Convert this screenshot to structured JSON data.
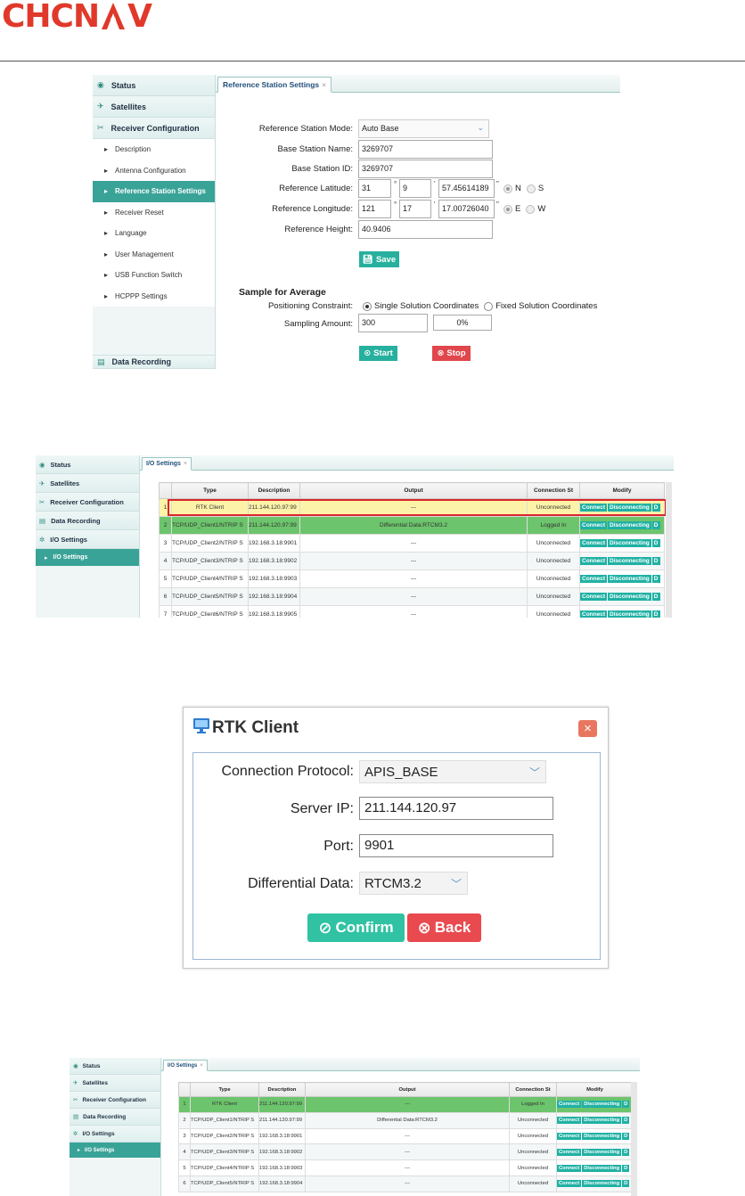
{
  "logo": {
    "text_left": "CHCN",
    "text_right": "V",
    "brand_color": "#e0392b"
  },
  "panel1": {
    "sidebar": [
      {
        "label": "Status",
        "icon": "status-icon"
      },
      {
        "label": "Satellites",
        "icon": "satellite-icon"
      },
      {
        "label": "Receiver Configuration",
        "icon": "tools-icon"
      }
    ],
    "subitems": [
      "Description",
      "Antenna Configuration",
      "Reference Station Settings",
      "Receiver Reset",
      "Language",
      "User Management",
      "USB Function Switch",
      "HCPPP Settings"
    ],
    "bottom_item": "Data Recording",
    "tab": "Reference Station Settings",
    "form": {
      "mode_label": "Reference Station Mode:",
      "mode_value": "Auto Base",
      "name_label": "Base Station Name:",
      "name_value": "3269707",
      "id_label": "Base Station ID:",
      "id_value": "3269707",
      "lat_label": "Reference Latitude:",
      "lat_deg": "31",
      "lat_min": "9",
      "lat_sec": "57.45614189",
      "lon_label": "Reference Longitude:",
      "lon_deg": "121",
      "lon_min": "17",
      "lon_sec": "17.00726040",
      "deg_unit": "°",
      "min_unit": "'",
      "sec_unit": "\"",
      "n": "N",
      "s": "S",
      "e": "E",
      "w": "W",
      "height_label": "Reference Height:",
      "height_value": "40.9406",
      "save": "Save",
      "section": "Sample for Average",
      "constraint_label": "Positioning Constraint:",
      "opt_single": "Single Solution Coordinates",
      "opt_fixed": "Fixed Solution Coordinates",
      "amount_label": "Sampling Amount:",
      "amount_value": "300",
      "progress": "0%",
      "start": "Start",
      "stop": "Stop"
    }
  },
  "io_sidebar": {
    "items": [
      "Status",
      "Satellites",
      "Receiver Configuration",
      "Data Recording",
      "I/O Settings"
    ],
    "sub": "I/O Settings"
  },
  "io_tab": "I/O Settings",
  "table_headers": [
    "Type",
    "Description",
    "Output",
    "Connection St",
    "Modify"
  ],
  "buttons": {
    "connect": "Connect",
    "disconnect": "Disconnecting",
    "d": "D"
  },
  "table1": [
    {
      "n": "1",
      "type": "RTK Client",
      "desc": "211.144.120.97:99",
      "output": "---",
      "status": "Unconnected"
    },
    {
      "n": "2",
      "type": "TCP/UDP_Client1/NTRIP S",
      "desc": "211.144.120.97:99",
      "output": "Differential Data:RTCM3.2",
      "status": "Logged In"
    },
    {
      "n": "3",
      "type": "TCP/UDP_Client2/NTRIP S",
      "desc": "192.168.3.18:9901",
      "output": "---",
      "status": "Unconnected"
    },
    {
      "n": "4",
      "type": "TCP/UDP_Client3/NTRIP S",
      "desc": "192.168.3.18:9902",
      "output": "---",
      "status": "Unconnected"
    },
    {
      "n": "5",
      "type": "TCP/UDP_Client4/NTRIP S",
      "desc": "192.168.3.18:9903",
      "output": "---",
      "status": "Unconnected"
    },
    {
      "n": "6",
      "type": "TCP/UDP_Client5/NTRIP S",
      "desc": "192.168.3.18:9904",
      "output": "---",
      "status": "Unconnected"
    },
    {
      "n": "7",
      "type": "TCP/UDP_Client6/NTRIP S",
      "desc": "192.168.3.18:9905",
      "output": "---",
      "status": "Unconnected"
    }
  ],
  "dialog": {
    "title": "RTK Client",
    "protocol_label": "Connection Protocol:",
    "protocol_value": "APIS_BASE",
    "ip_label": "Server IP:",
    "ip_value": "211.144.120.97",
    "port_label": "Port:",
    "port_value": "9901",
    "diff_label": "Differential Data:",
    "diff_value": "RTCM3.2",
    "confirm": "Confirm",
    "back": "Back"
  },
  "table2": [
    {
      "n": "1",
      "type": "RTK Client",
      "desc": "211.144.120.97:99",
      "output": "---",
      "status": "Logged In"
    },
    {
      "n": "2",
      "type": "TCP/UDP_Client1/NTRIP S",
      "desc": "211.144.120.97:99",
      "output": "Differential Data:RTCM3.2",
      "status": "Unconnected"
    },
    {
      "n": "3",
      "type": "TCP/UDP_Client2/NTRIP S",
      "desc": "192.168.3.18:9901",
      "output": "---",
      "status": "Unconnected"
    },
    {
      "n": "4",
      "type": "TCP/UDP_Client3/NTRIP S",
      "desc": "192.168.3.18:9902",
      "output": "---",
      "status": "Unconnected"
    },
    {
      "n": "5",
      "type": "TCP/UDP_Client4/NTRIP S",
      "desc": "192.168.3.18:9903",
      "output": "---",
      "status": "Unconnected"
    },
    {
      "n": "6",
      "type": "TCP/UDP_Client5/NTRIP S",
      "desc": "192.168.3.18:9904",
      "output": "---",
      "status": "Unconnected"
    }
  ]
}
